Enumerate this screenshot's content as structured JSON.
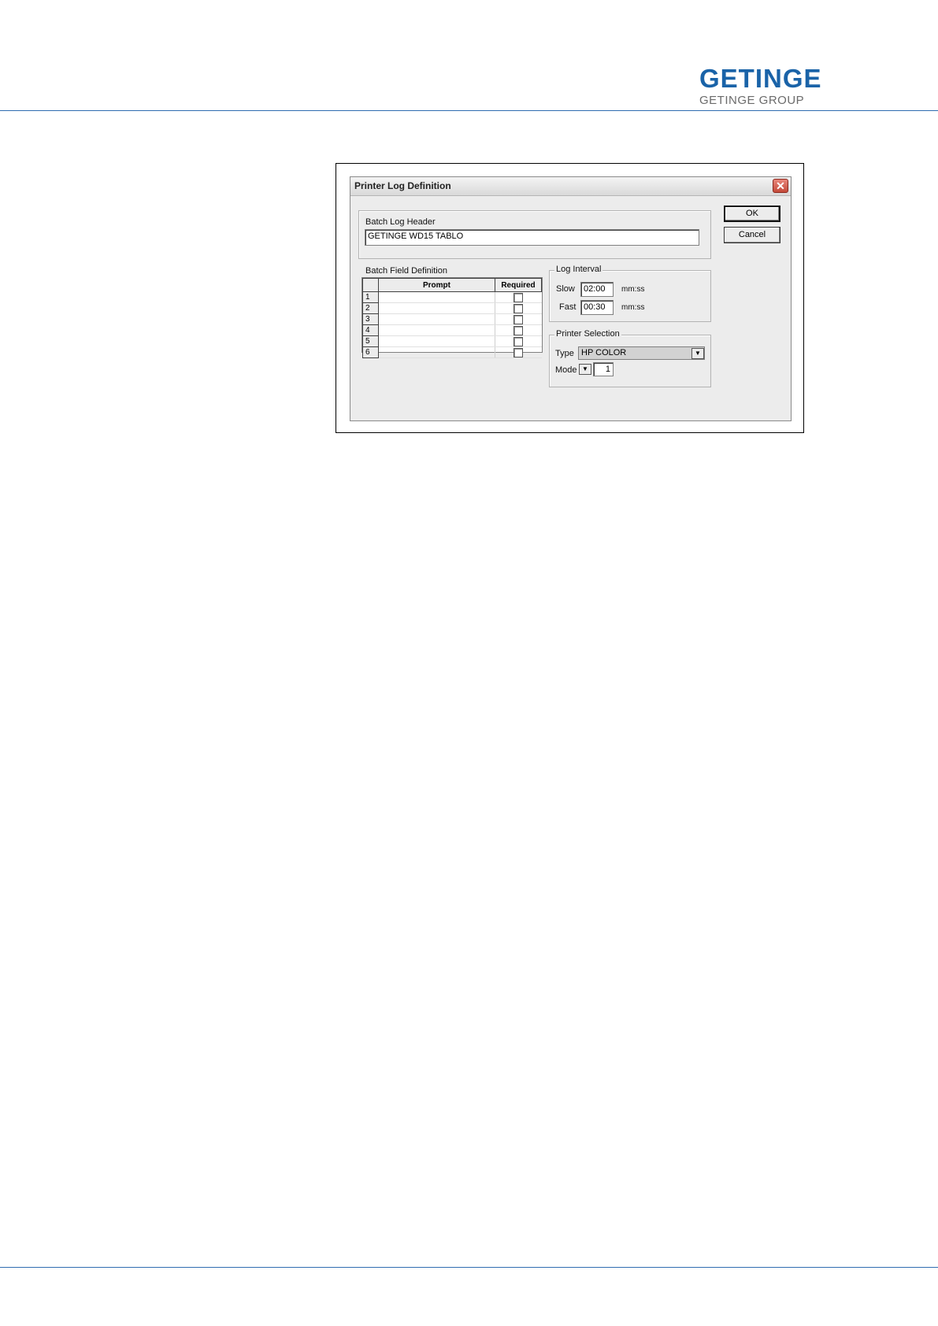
{
  "brand": {
    "name": "GETINGE",
    "group": "GETINGE GROUP",
    "color": "#1a63a8"
  },
  "dialog": {
    "title": "Printer Log Definition",
    "close_glyph": "✕",
    "ok_label": "OK",
    "cancel_label": "Cancel",
    "batch_log_header": {
      "label": "Batch Log Header",
      "value": "GETINGE WD15 TABLO"
    },
    "batch_field_definition": {
      "label": "Batch Field Definition",
      "columns": [
        "Prompt",
        "Required"
      ],
      "rows": [
        {
          "num": "1",
          "prompt": "",
          "required": false
        },
        {
          "num": "2",
          "prompt": "",
          "required": false
        },
        {
          "num": "3",
          "prompt": "",
          "required": false
        },
        {
          "num": "4",
          "prompt": "",
          "required": false
        },
        {
          "num": "5",
          "prompt": "",
          "required": false
        },
        {
          "num": "6",
          "prompt": "",
          "required": false
        }
      ]
    },
    "log_interval": {
      "label": "Log Interval",
      "slow_label": "Slow",
      "slow_value": "02:00",
      "fast_label": "Fast",
      "fast_value": "00:30",
      "unit": "mm:ss"
    },
    "printer_selection": {
      "label": "Printer Selection",
      "type_label": "Type",
      "type_value": "HP COLOR",
      "mode_label": "Mode",
      "mode_value": "1"
    }
  }
}
